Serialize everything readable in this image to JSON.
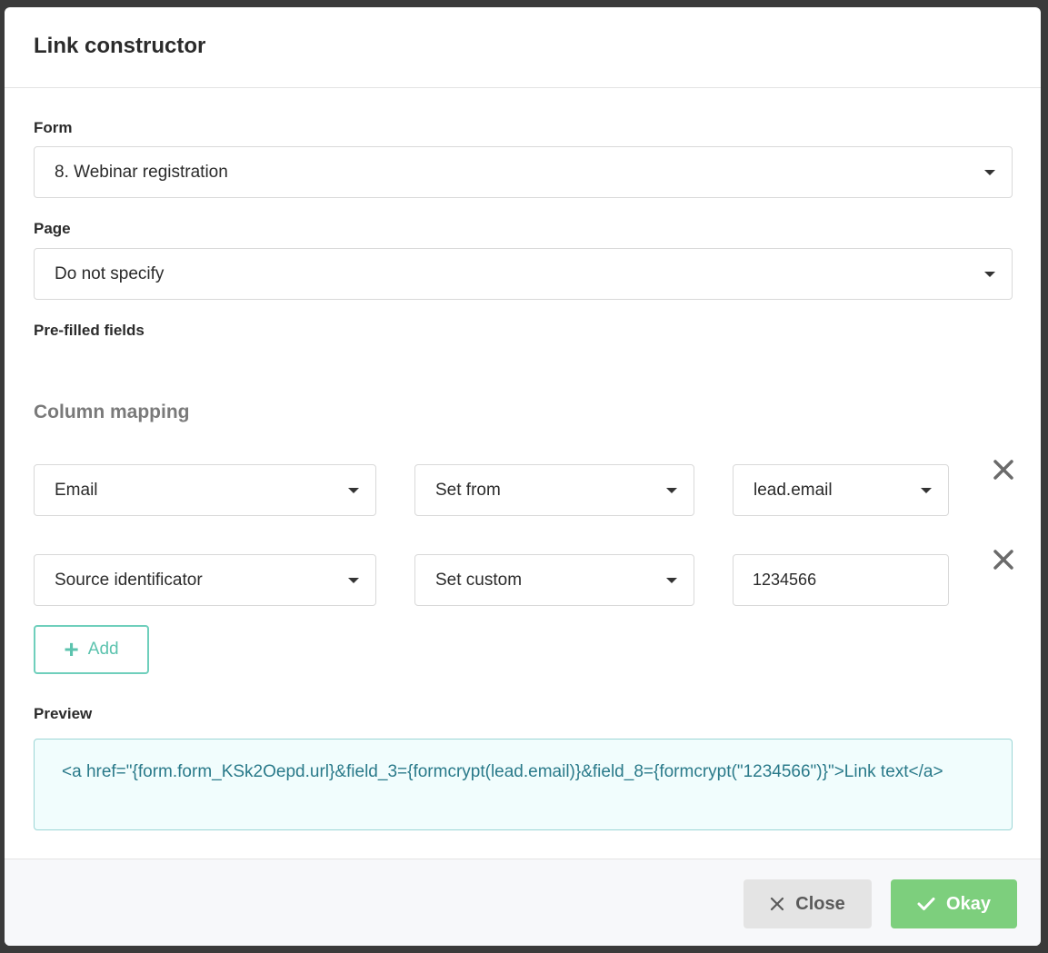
{
  "modal": {
    "title": "Link constructor"
  },
  "form": {
    "label": "Form",
    "selected": "8. Webinar registration"
  },
  "page": {
    "label": "Page",
    "selected": "Do not specify"
  },
  "prefilled": {
    "label": "Pre-filled fields"
  },
  "mapping": {
    "title": "Column mapping",
    "rows": [
      {
        "field": "Email",
        "mode": "Set from",
        "value": "lead.email",
        "value_type": "select"
      },
      {
        "field": "Source identificator",
        "mode": "Set custom",
        "value": "1234566",
        "value_type": "input"
      }
    ],
    "add_label": "Add"
  },
  "preview": {
    "label": "Preview",
    "text": "<a href=\"{form.form_KSk2Oepd.url}&field_3={formcrypt(lead.email)}&field_8={formcrypt(\"1234566\")}\">Link text</a>"
  },
  "footer": {
    "close_label": "Close",
    "okay_label": "Okay"
  },
  "icons": {
    "dropdown": "caret-down-icon",
    "remove": "close-x-icon",
    "add": "plus-icon",
    "close": "close-x-icon",
    "okay": "checkmark-icon"
  },
  "colors": {
    "accent": "#6fcfbc",
    "okay": "#7dcf7d",
    "preview_text": "#2a7a8a",
    "preview_bg": "#f1fdfd"
  }
}
